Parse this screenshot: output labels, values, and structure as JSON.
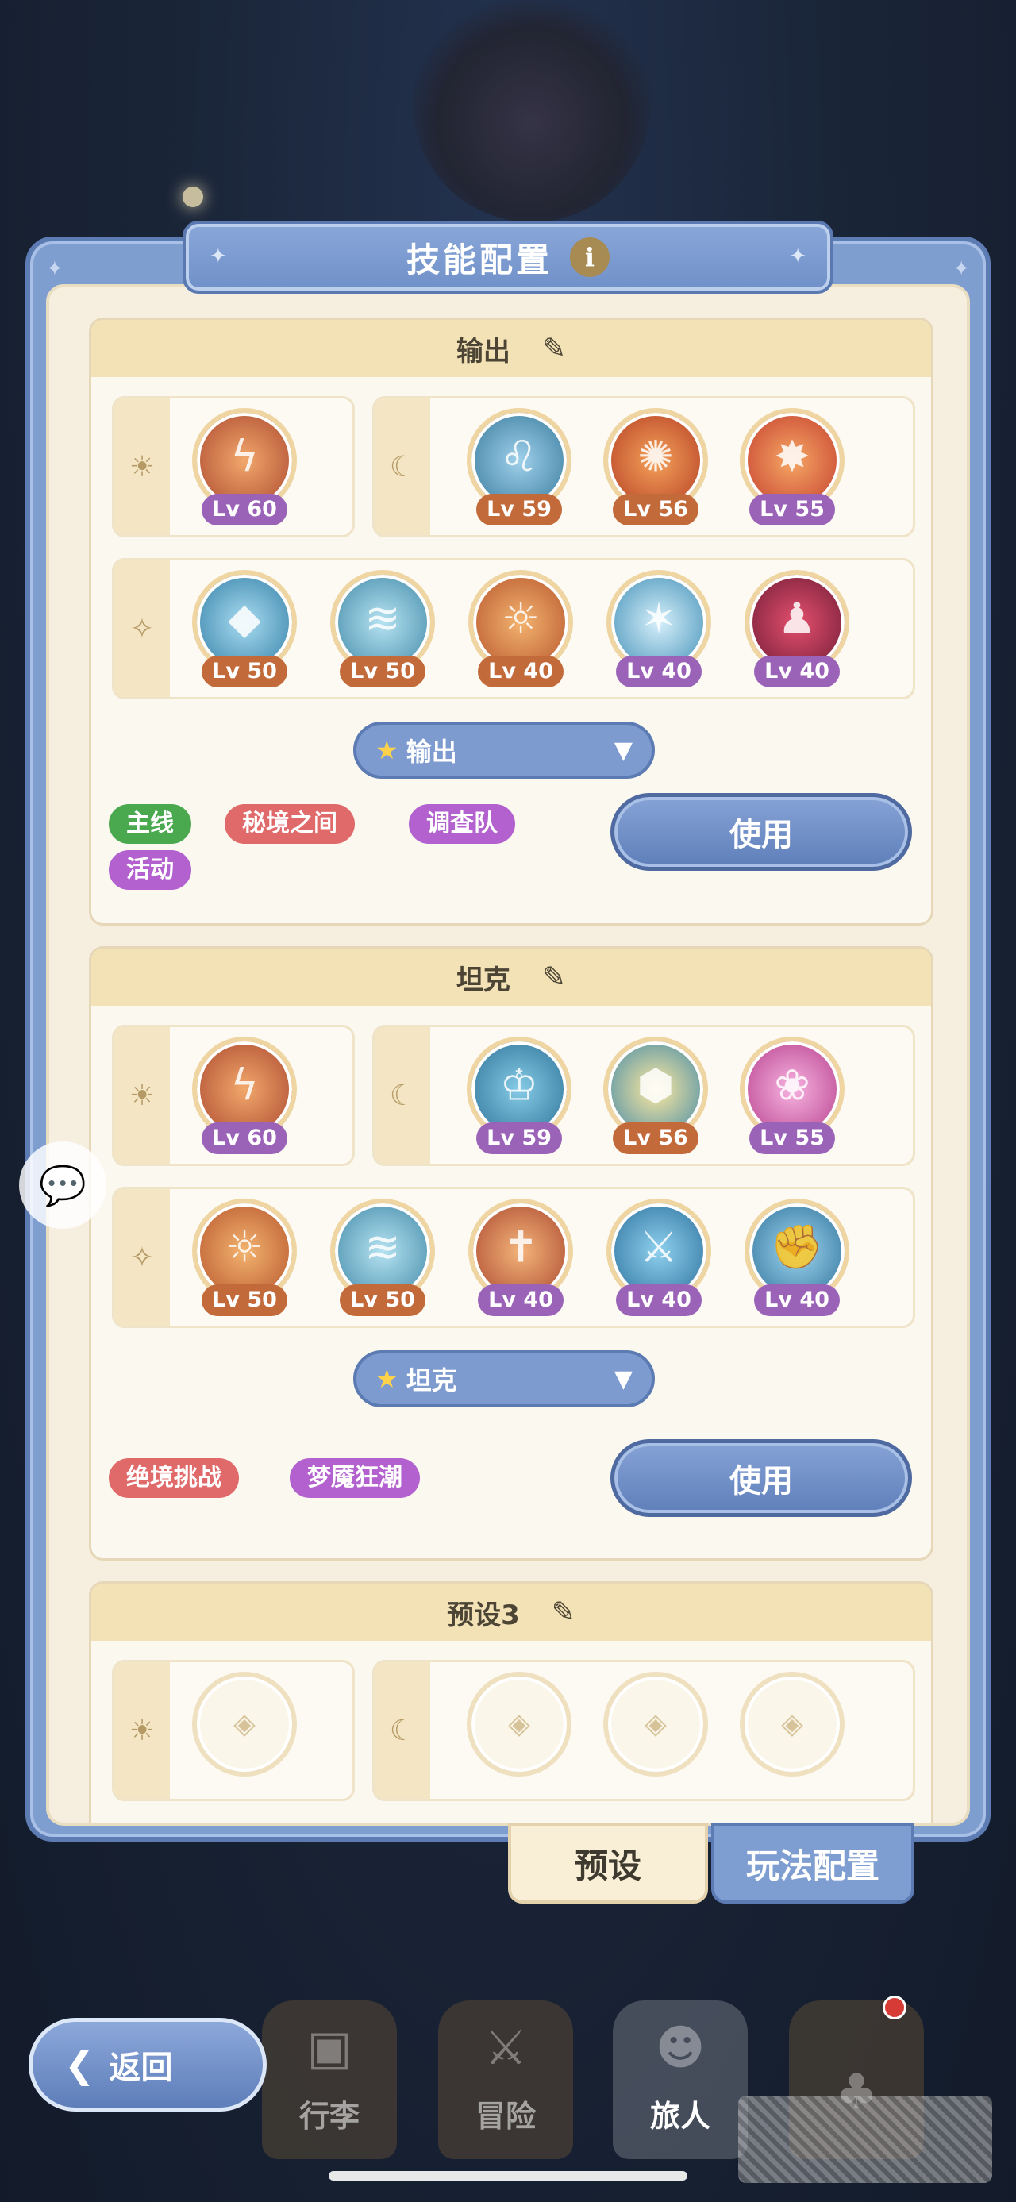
{
  "dialog": {
    "title": "技能配置",
    "info_icon": "info-icon"
  },
  "presets": [
    {
      "name": "输出",
      "row1_left": [
        {
          "level": "Lv 60",
          "color": "purple"
        }
      ],
      "row1_right": [
        {
          "level": "Lv 59",
          "color": "orange"
        },
        {
          "level": "Lv 56",
          "color": "orange"
        },
        {
          "level": "Lv 55",
          "color": "purple"
        }
      ],
      "row2": [
        {
          "level": "Lv 50",
          "color": "orange"
        },
        {
          "level": "Lv 50",
          "color": "orange"
        },
        {
          "level": "Lv 40",
          "color": "orange"
        },
        {
          "level": "Lv 40",
          "color": "purple"
        },
        {
          "level": "Lv 40",
          "color": "purple"
        }
      ],
      "role": "输出",
      "tags": [
        "主线",
        "秘境之间",
        "调查队",
        "活动"
      ],
      "use_label": "使用"
    },
    {
      "name": "坦克",
      "row1_left": [
        {
          "level": "Lv 60",
          "color": "purple"
        }
      ],
      "row1_right": [
        {
          "level": "Lv 59",
          "color": "purple"
        },
        {
          "level": "Lv 56",
          "color": "orange"
        },
        {
          "level": "Lv 55",
          "color": "purple"
        }
      ],
      "row2": [
        {
          "level": "Lv 50",
          "color": "orange"
        },
        {
          "level": "Lv 50",
          "color": "orange"
        },
        {
          "level": "Lv 40",
          "color": "purple"
        },
        {
          "level": "Lv 40",
          "color": "purple"
        },
        {
          "level": "Lv 40",
          "color": "purple"
        }
      ],
      "role": "坦克",
      "tags": [
        "绝境挑战",
        "梦魇狂潮"
      ],
      "use_label": "使用"
    },
    {
      "name": "预设3"
    }
  ],
  "tabs": {
    "preset": "预设",
    "play_config": "玩法配置"
  },
  "nav": {
    "back": "返回",
    "luggage": "行李",
    "adventure": "冒险",
    "traveler": "旅人"
  },
  "colors": {
    "accent": "#7e9ed0",
    "orange_level": "#c36a3a",
    "purple_level": "#9a63b8",
    "tag_green": "#4aa84f",
    "tag_red": "#e06a6a",
    "tag_purple": "#b261cf"
  }
}
